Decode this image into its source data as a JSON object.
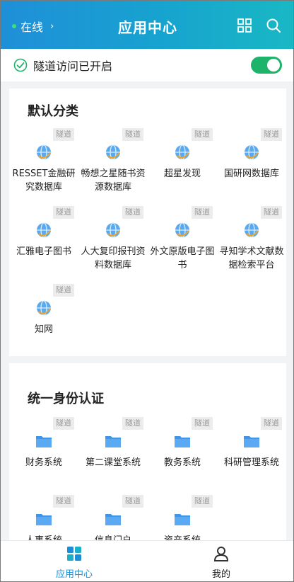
{
  "header": {
    "status_label": "在线",
    "title": "应用中心",
    "grid_icon": "grid-icon",
    "search_icon": "search-icon"
  },
  "tunnel": {
    "label": "隧道访问已开启",
    "enabled": true
  },
  "sections": [
    {
      "title": "默认分类",
      "items": [
        {
          "name": "RESSET金融研究数据库",
          "badge": "隧道",
          "icon": "globe-icon"
        },
        {
          "name": "畅想之星随书资源数据库",
          "badge": "隧道",
          "icon": "globe-icon"
        },
        {
          "name": "超星发现",
          "badge": "隧道",
          "icon": "globe-icon"
        },
        {
          "name": "国研网数据库",
          "badge": "隧道",
          "icon": "globe-icon"
        },
        {
          "name": "汇雅电子图书",
          "badge": "隧道",
          "icon": "globe-icon"
        },
        {
          "name": "人大复印报刊资料数据库",
          "badge": "隧道",
          "icon": "globe-icon"
        },
        {
          "name": "外文原版电子图书",
          "badge": "隧道",
          "icon": "globe-icon"
        },
        {
          "name": "寻知学术文献数据检索平台",
          "badge": "隧道",
          "icon": "globe-icon"
        },
        {
          "name": "知网",
          "badge": "隧道",
          "icon": "globe-icon"
        }
      ]
    },
    {
      "title": "统一身份认证",
      "items": [
        {
          "name": "财务系统",
          "badge": "隧道",
          "icon": "folder-icon"
        },
        {
          "name": "第二课堂系统",
          "badge": "隧道",
          "icon": "folder-icon"
        },
        {
          "name": "教务系统",
          "badge": "隧道",
          "icon": "folder-icon"
        },
        {
          "name": "科研管理系统",
          "badge": "隧道",
          "icon": "folder-icon"
        },
        {
          "name": "人事系统",
          "badge": "隧道",
          "icon": "folder-icon"
        },
        {
          "name": "信息门户",
          "badge": "隧道",
          "icon": "folder-icon"
        },
        {
          "name": "资产系统",
          "badge": "隧道",
          "icon": "folder-icon"
        }
      ]
    }
  ],
  "tabbar": {
    "tabs": [
      {
        "label": "应用中心",
        "icon": "app-center-icon",
        "active": true
      },
      {
        "label": "我的",
        "icon": "user-icon",
        "active": false
      }
    ]
  },
  "colors": {
    "accent": "#1a8fd6",
    "toggle_on": "#1eb36b",
    "tab_active": "#1a8fd6"
  }
}
